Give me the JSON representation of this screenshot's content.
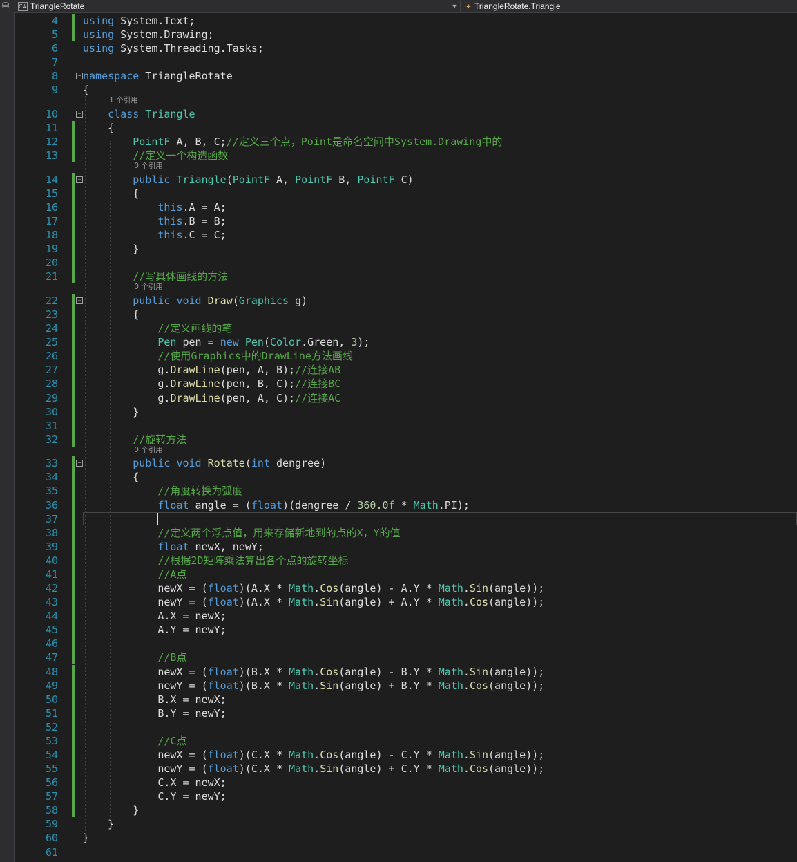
{
  "header": {
    "project_label": "TriangleRotate",
    "project_icon": "csharp-project-icon",
    "member_label": "TriangleRotate.Triangle",
    "member_icon": "class-icon"
  },
  "editor": {
    "theme": {
      "background": "#1e1e1e",
      "keyword": "#569cd6",
      "type": "#4ec9b0",
      "comment": "#57a64a",
      "number": "#b5cea8",
      "method": "#dcdcaa",
      "line_number": "#2b91af",
      "change_bar": "#57a64a"
    },
    "current_line": 37,
    "lines": [
      {
        "n": 4,
        "tokens": [
          [
            "kw",
            "using"
          ],
          [
            "p",
            " System.Text;"
          ]
        ],
        "chg": true
      },
      {
        "n": 5,
        "tokens": [
          [
            "kw",
            "using"
          ],
          [
            "p",
            " System.Drawing;"
          ]
        ],
        "chg": true
      },
      {
        "n": 6,
        "tokens": [
          [
            "kw",
            "using"
          ],
          [
            "p",
            " System.Threading.Tasks;"
          ]
        ]
      },
      {
        "n": 7,
        "tokens": []
      },
      {
        "n": 8,
        "fold": true,
        "tokens": [
          [
            "kw",
            "namespace"
          ],
          [
            "p",
            " TriangleRotate"
          ]
        ]
      },
      {
        "n": 9,
        "tokens": [
          [
            "p",
            "{"
          ]
        ]
      },
      {
        "lens": "1 个引用",
        "lensIndent": 1
      },
      {
        "n": 10,
        "fold": true,
        "tokens": [
          [
            "p",
            "    "
          ],
          [
            "kw",
            "class"
          ],
          [
            "p",
            " "
          ],
          [
            "ty",
            "Triangle"
          ]
        ]
      },
      {
        "n": 11,
        "chg": true,
        "tokens": [
          [
            "p",
            "    {"
          ]
        ]
      },
      {
        "n": 12,
        "chg": true,
        "tokens": [
          [
            "p",
            "        "
          ],
          [
            "ty",
            "PointF"
          ],
          [
            "p",
            " A, B, C;"
          ],
          [
            "cm",
            "//定义三个点，Point是命名空间中System.Drawing中的"
          ]
        ]
      },
      {
        "n": 13,
        "chg": true,
        "tokens": [
          [
            "p",
            "        "
          ],
          [
            "cm",
            "//定义一个构造函数"
          ]
        ]
      },
      {
        "lens": "0 个引用",
        "lensIndent": 2
      },
      {
        "n": 14,
        "fold": true,
        "chg": true,
        "tokens": [
          [
            "p",
            "        "
          ],
          [
            "kw",
            "public"
          ],
          [
            "p",
            " "
          ],
          [
            "ty",
            "Triangle"
          ],
          [
            "p",
            "("
          ],
          [
            "ty",
            "PointF"
          ],
          [
            "p",
            " A, "
          ],
          [
            "ty",
            "PointF"
          ],
          [
            "p",
            " B, "
          ],
          [
            "ty",
            "PointF"
          ],
          [
            "p",
            " C)"
          ]
        ]
      },
      {
        "n": 15,
        "chg": true,
        "tokens": [
          [
            "p",
            "        {"
          ]
        ]
      },
      {
        "n": 16,
        "chg": true,
        "tokens": [
          [
            "p",
            "            "
          ],
          [
            "kw",
            "this"
          ],
          [
            "p",
            ".A = A;"
          ]
        ]
      },
      {
        "n": 17,
        "chg": true,
        "tokens": [
          [
            "p",
            "            "
          ],
          [
            "kw",
            "this"
          ],
          [
            "p",
            ".B = B;"
          ]
        ]
      },
      {
        "n": 18,
        "chg": true,
        "tokens": [
          [
            "p",
            "            "
          ],
          [
            "kw",
            "this"
          ],
          [
            "p",
            ".C = C;"
          ]
        ]
      },
      {
        "n": 19,
        "chg": true,
        "tokens": [
          [
            "p",
            "        }"
          ]
        ]
      },
      {
        "n": 20,
        "chg": true,
        "tokens": []
      },
      {
        "n": 21,
        "chg": true,
        "tokens": [
          [
            "p",
            "        "
          ],
          [
            "cm",
            "//写具体画线的方法"
          ]
        ]
      },
      {
        "lens": "0 个引用",
        "lensIndent": 2
      },
      {
        "n": 22,
        "fold": true,
        "chg": true,
        "tokens": [
          [
            "p",
            "        "
          ],
          [
            "kw",
            "public"
          ],
          [
            "p",
            " "
          ],
          [
            "kw",
            "void"
          ],
          [
            "p",
            " "
          ],
          [
            "mt",
            "Draw"
          ],
          [
            "p",
            "("
          ],
          [
            "ty",
            "Graphics"
          ],
          [
            "p",
            " g)"
          ]
        ]
      },
      {
        "n": 23,
        "chg": true,
        "tokens": [
          [
            "p",
            "        {"
          ]
        ]
      },
      {
        "n": 24,
        "chg": true,
        "tokens": [
          [
            "p",
            "            "
          ],
          [
            "cm",
            "//定义画线的笔"
          ]
        ]
      },
      {
        "n": 25,
        "chg": true,
        "tokens": [
          [
            "p",
            "            "
          ],
          [
            "ty",
            "Pen"
          ],
          [
            "p",
            " pen = "
          ],
          [
            "kw",
            "new"
          ],
          [
            "p",
            " "
          ],
          [
            "ty",
            "Pen"
          ],
          [
            "p",
            "("
          ],
          [
            "ty",
            "Color"
          ],
          [
            "p",
            ".Green, "
          ],
          [
            "num",
            "3"
          ],
          [
            "p",
            ");"
          ]
        ]
      },
      {
        "n": 26,
        "chg": true,
        "tokens": [
          [
            "p",
            "            "
          ],
          [
            "cm",
            "//使用Graphics中的DrawLine方法画线"
          ]
        ]
      },
      {
        "n": 27,
        "chg": true,
        "tokens": [
          [
            "p",
            "            g."
          ],
          [
            "mt",
            "DrawLine"
          ],
          [
            "p",
            "(pen, A, B);"
          ],
          [
            "cm",
            "//连接AB"
          ]
        ]
      },
      {
        "n": 28,
        "chg": true,
        "tokens": [
          [
            "p",
            "            g."
          ],
          [
            "mt",
            "DrawLine"
          ],
          [
            "p",
            "(pen, B, C);"
          ],
          [
            "cm",
            "//连接BC"
          ]
        ]
      },
      {
        "n": 29,
        "chg": true,
        "tokens": [
          [
            "p",
            "            g."
          ],
          [
            "mt",
            "DrawLine"
          ],
          [
            "p",
            "(pen, A, C);"
          ],
          [
            "cm",
            "//连接AC"
          ]
        ]
      },
      {
        "n": 30,
        "chg": true,
        "tokens": [
          [
            "p",
            "        }"
          ]
        ]
      },
      {
        "n": 31,
        "chg": true,
        "tokens": []
      },
      {
        "n": 32,
        "chg": true,
        "tokens": [
          [
            "p",
            "        "
          ],
          [
            "cm",
            "//旋转方法"
          ]
        ]
      },
      {
        "lens": "0 个引用",
        "lensIndent": 2
      },
      {
        "n": 33,
        "fold": true,
        "chg": true,
        "tokens": [
          [
            "p",
            "        "
          ],
          [
            "kw",
            "public"
          ],
          [
            "p",
            " "
          ],
          [
            "kw",
            "void"
          ],
          [
            "p",
            " "
          ],
          [
            "mt",
            "Rotate"
          ],
          [
            "p",
            "("
          ],
          [
            "kw",
            "int"
          ],
          [
            "p",
            " dengree)"
          ]
        ]
      },
      {
        "n": 34,
        "chg": true,
        "tokens": [
          [
            "p",
            "        {"
          ]
        ]
      },
      {
        "n": 35,
        "chg": true,
        "tokens": [
          [
            "p",
            "            "
          ],
          [
            "cm",
            "//角度转换为弧度"
          ]
        ]
      },
      {
        "n": 36,
        "chg": true,
        "tokens": [
          [
            "p",
            "            "
          ],
          [
            "kw",
            "float"
          ],
          [
            "p",
            " angle = ("
          ],
          [
            "kw",
            "float"
          ],
          [
            "p",
            ")(dengree / "
          ],
          [
            "num",
            "360.0f"
          ],
          [
            "p",
            " * "
          ],
          [
            "ty",
            "Math"
          ],
          [
            "p",
            ".PI);"
          ]
        ]
      },
      {
        "n": 37,
        "chg": true,
        "tokens": [],
        "current": true
      },
      {
        "n": 38,
        "chg": true,
        "tokens": [
          [
            "p",
            "            "
          ],
          [
            "cm",
            "//定义两个浮点值，用来存储新地到的点的X，Y的值"
          ]
        ]
      },
      {
        "n": 39,
        "chg": true,
        "tokens": [
          [
            "p",
            "            "
          ],
          [
            "kw",
            "float"
          ],
          [
            "p",
            " newX, newY;"
          ]
        ]
      },
      {
        "n": 40,
        "chg": true,
        "tokens": [
          [
            "p",
            "            "
          ],
          [
            "cm",
            "//根据2D矩阵乘法算出各个点的旋转坐标"
          ]
        ]
      },
      {
        "n": 41,
        "chg": true,
        "tokens": [
          [
            "p",
            "            "
          ],
          [
            "cm",
            "//A点"
          ]
        ]
      },
      {
        "n": 42,
        "chg": true,
        "tokens": [
          [
            "p",
            "            newX = ("
          ],
          [
            "kw",
            "float"
          ],
          [
            "p",
            ")(A.X * "
          ],
          [
            "ty",
            "Math"
          ],
          [
            "p",
            "."
          ],
          [
            "mt",
            "Cos"
          ],
          [
            "p",
            "(angle) - A.Y * "
          ],
          [
            "ty",
            "Math"
          ],
          [
            "p",
            "."
          ],
          [
            "mt",
            "Sin"
          ],
          [
            "p",
            "(angle));"
          ]
        ]
      },
      {
        "n": 43,
        "chg": true,
        "tokens": [
          [
            "p",
            "            newY = ("
          ],
          [
            "kw",
            "float"
          ],
          [
            "p",
            ")(A.X * "
          ],
          [
            "ty",
            "Math"
          ],
          [
            "p",
            "."
          ],
          [
            "mt",
            "Sin"
          ],
          [
            "p",
            "(angle) + A.Y * "
          ],
          [
            "ty",
            "Math"
          ],
          [
            "p",
            "."
          ],
          [
            "mt",
            "Cos"
          ],
          [
            "p",
            "(angle));"
          ]
        ]
      },
      {
        "n": 44,
        "chg": true,
        "tokens": [
          [
            "p",
            "            A.X = newX;"
          ]
        ]
      },
      {
        "n": 45,
        "chg": true,
        "tokens": [
          [
            "p",
            "            A.Y = newY;"
          ]
        ]
      },
      {
        "n": 46,
        "chg": true,
        "tokens": []
      },
      {
        "n": 47,
        "chg": true,
        "tokens": [
          [
            "p",
            "            "
          ],
          [
            "cm",
            "//B点"
          ]
        ]
      },
      {
        "n": 48,
        "chg": true,
        "tokens": [
          [
            "p",
            "            newX = ("
          ],
          [
            "kw",
            "float"
          ],
          [
            "p",
            ")(B.X * "
          ],
          [
            "ty",
            "Math"
          ],
          [
            "p",
            "."
          ],
          [
            "mt",
            "Cos"
          ],
          [
            "p",
            "(angle) - B.Y * "
          ],
          [
            "ty",
            "Math"
          ],
          [
            "p",
            "."
          ],
          [
            "mt",
            "Sin"
          ],
          [
            "p",
            "(angle));"
          ]
        ]
      },
      {
        "n": 49,
        "chg": true,
        "tokens": [
          [
            "p",
            "            newY = ("
          ],
          [
            "kw",
            "float"
          ],
          [
            "p",
            ")(B.X * "
          ],
          [
            "ty",
            "Math"
          ],
          [
            "p",
            "."
          ],
          [
            "mt",
            "Sin"
          ],
          [
            "p",
            "(angle) + B.Y * "
          ],
          [
            "ty",
            "Math"
          ],
          [
            "p",
            "."
          ],
          [
            "mt",
            "Cos"
          ],
          [
            "p",
            "(angle));"
          ]
        ]
      },
      {
        "n": 50,
        "chg": true,
        "tokens": [
          [
            "p",
            "            B.X = newX;"
          ]
        ]
      },
      {
        "n": 51,
        "chg": true,
        "tokens": [
          [
            "p",
            "            B.Y = newY;"
          ]
        ]
      },
      {
        "n": 52,
        "chg": true,
        "tokens": []
      },
      {
        "n": 53,
        "chg": true,
        "tokens": [
          [
            "p",
            "            "
          ],
          [
            "cm",
            "//C点"
          ]
        ]
      },
      {
        "n": 54,
        "chg": true,
        "tokens": [
          [
            "p",
            "            newX = ("
          ],
          [
            "kw",
            "float"
          ],
          [
            "p",
            ")(C.X * "
          ],
          [
            "ty",
            "Math"
          ],
          [
            "p",
            "."
          ],
          [
            "mt",
            "Cos"
          ],
          [
            "p",
            "(angle) - C.Y * "
          ],
          [
            "ty",
            "Math"
          ],
          [
            "p",
            "."
          ],
          [
            "mt",
            "Sin"
          ],
          [
            "p",
            "(angle));"
          ]
        ]
      },
      {
        "n": 55,
        "chg": true,
        "tokens": [
          [
            "p",
            "            newY = ("
          ],
          [
            "kw",
            "float"
          ],
          [
            "p",
            ")(C.X * "
          ],
          [
            "ty",
            "Math"
          ],
          [
            "p",
            "."
          ],
          [
            "mt",
            "Sin"
          ],
          [
            "p",
            "(angle) + C.Y * "
          ],
          [
            "ty",
            "Math"
          ],
          [
            "p",
            "."
          ],
          [
            "mt",
            "Cos"
          ],
          [
            "p",
            "(angle));"
          ]
        ]
      },
      {
        "n": 56,
        "chg": true,
        "tokens": [
          [
            "p",
            "            C.X = newX;"
          ]
        ]
      },
      {
        "n": 57,
        "chg": true,
        "tokens": [
          [
            "p",
            "            C.Y = newY;"
          ]
        ]
      },
      {
        "n": 58,
        "chg": true,
        "tokens": [
          [
            "p",
            "        }"
          ]
        ]
      },
      {
        "n": 59,
        "tokens": [
          [
            "p",
            "    }"
          ]
        ]
      },
      {
        "n": 60,
        "tokens": [
          [
            "p",
            "}"
          ]
        ]
      },
      {
        "n": 61,
        "tokens": []
      }
    ]
  }
}
